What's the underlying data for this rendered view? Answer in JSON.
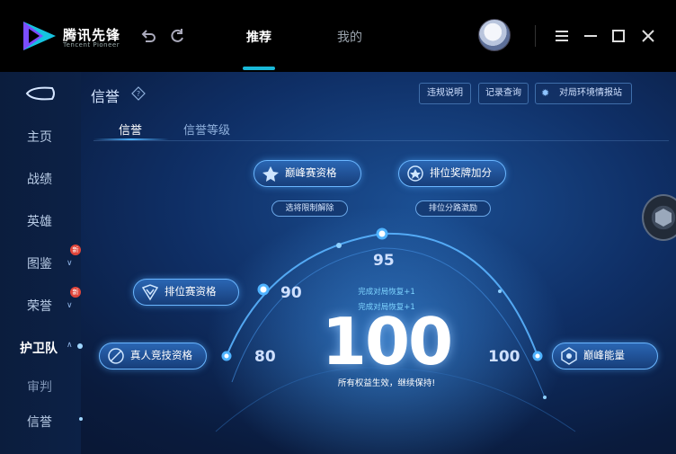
{
  "app": {
    "name": "腾讯先锋",
    "subtitle": "Tencent Pioneer"
  },
  "topnav": {
    "tabs": [
      {
        "label": "推荐",
        "active": true
      },
      {
        "label": "我的",
        "active": false
      }
    ]
  },
  "page": {
    "title": "信誉",
    "help_icon": "question-icon"
  },
  "header_buttons": [
    {
      "label": "违规说明"
    },
    {
      "label": "记录查询"
    },
    {
      "label": "对局环境情报站",
      "icon": "shield-icon"
    }
  ],
  "sidebar": {
    "items": [
      {
        "label": "主页"
      },
      {
        "label": "战绩"
      },
      {
        "label": "英雄"
      },
      {
        "label": "图鉴",
        "badge": "新"
      },
      {
        "label": "荣誉",
        "badge": "新"
      },
      {
        "label": "护卫队",
        "active": true
      },
      {
        "label": "审判"
      },
      {
        "label": "信誉"
      }
    ]
  },
  "subtabs": [
    {
      "label": "信誉",
      "active": true
    },
    {
      "label": "信誉等级",
      "active": false
    }
  ],
  "rewards": {
    "peak_qualify": "巅峰赛资格",
    "peak_sub": "选将限制解除",
    "rank_bonus": "排位奖牌加分",
    "rank_bonus_sub": "排位分路激励",
    "rank_qualify": "排位赛资格",
    "real_compete": "真人竞技资格",
    "peak_energy": "巅峰能量"
  },
  "scale": {
    "s80": "80",
    "s90": "90",
    "s95": "95",
    "s100": "100"
  },
  "score": {
    "value": "100",
    "recover1": "完成对局恢复+1",
    "recover2": "完成对局恢复+1",
    "status": "所有权益生效，继续保持!"
  },
  "colors": {
    "accent": "#19b9d8",
    "badge": "#e0453a",
    "glow": "#6ab6ff"
  }
}
